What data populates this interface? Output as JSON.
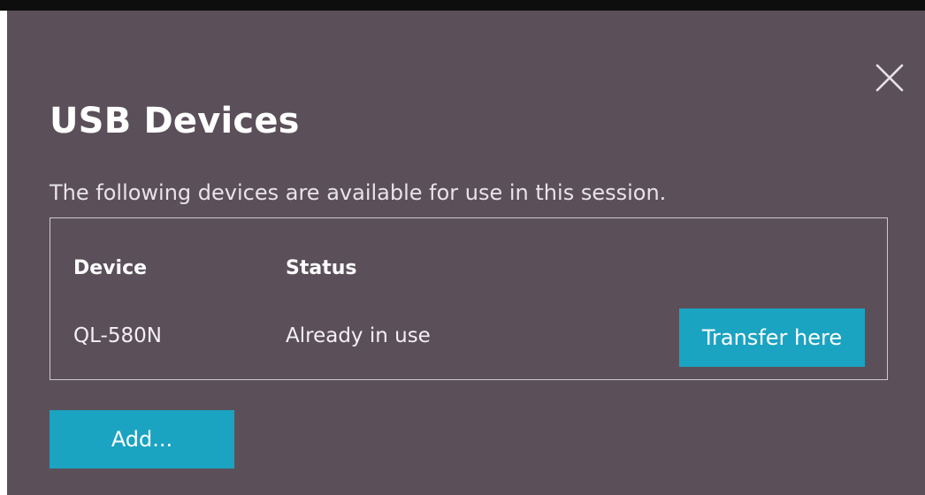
{
  "dialog": {
    "title": "USB Devices",
    "subtitle": "The following devices are available for use in this session.",
    "close_icon": "close-icon",
    "background_color": "#5b505a",
    "accent_color": "#1ba3c2"
  },
  "table": {
    "columns": [
      "Device",
      "Status"
    ],
    "rows": [
      {
        "device": "QL-580N",
        "status": "Already in use",
        "action_label": "Transfer here"
      }
    ]
  },
  "actions": {
    "add_label": "Add..."
  }
}
